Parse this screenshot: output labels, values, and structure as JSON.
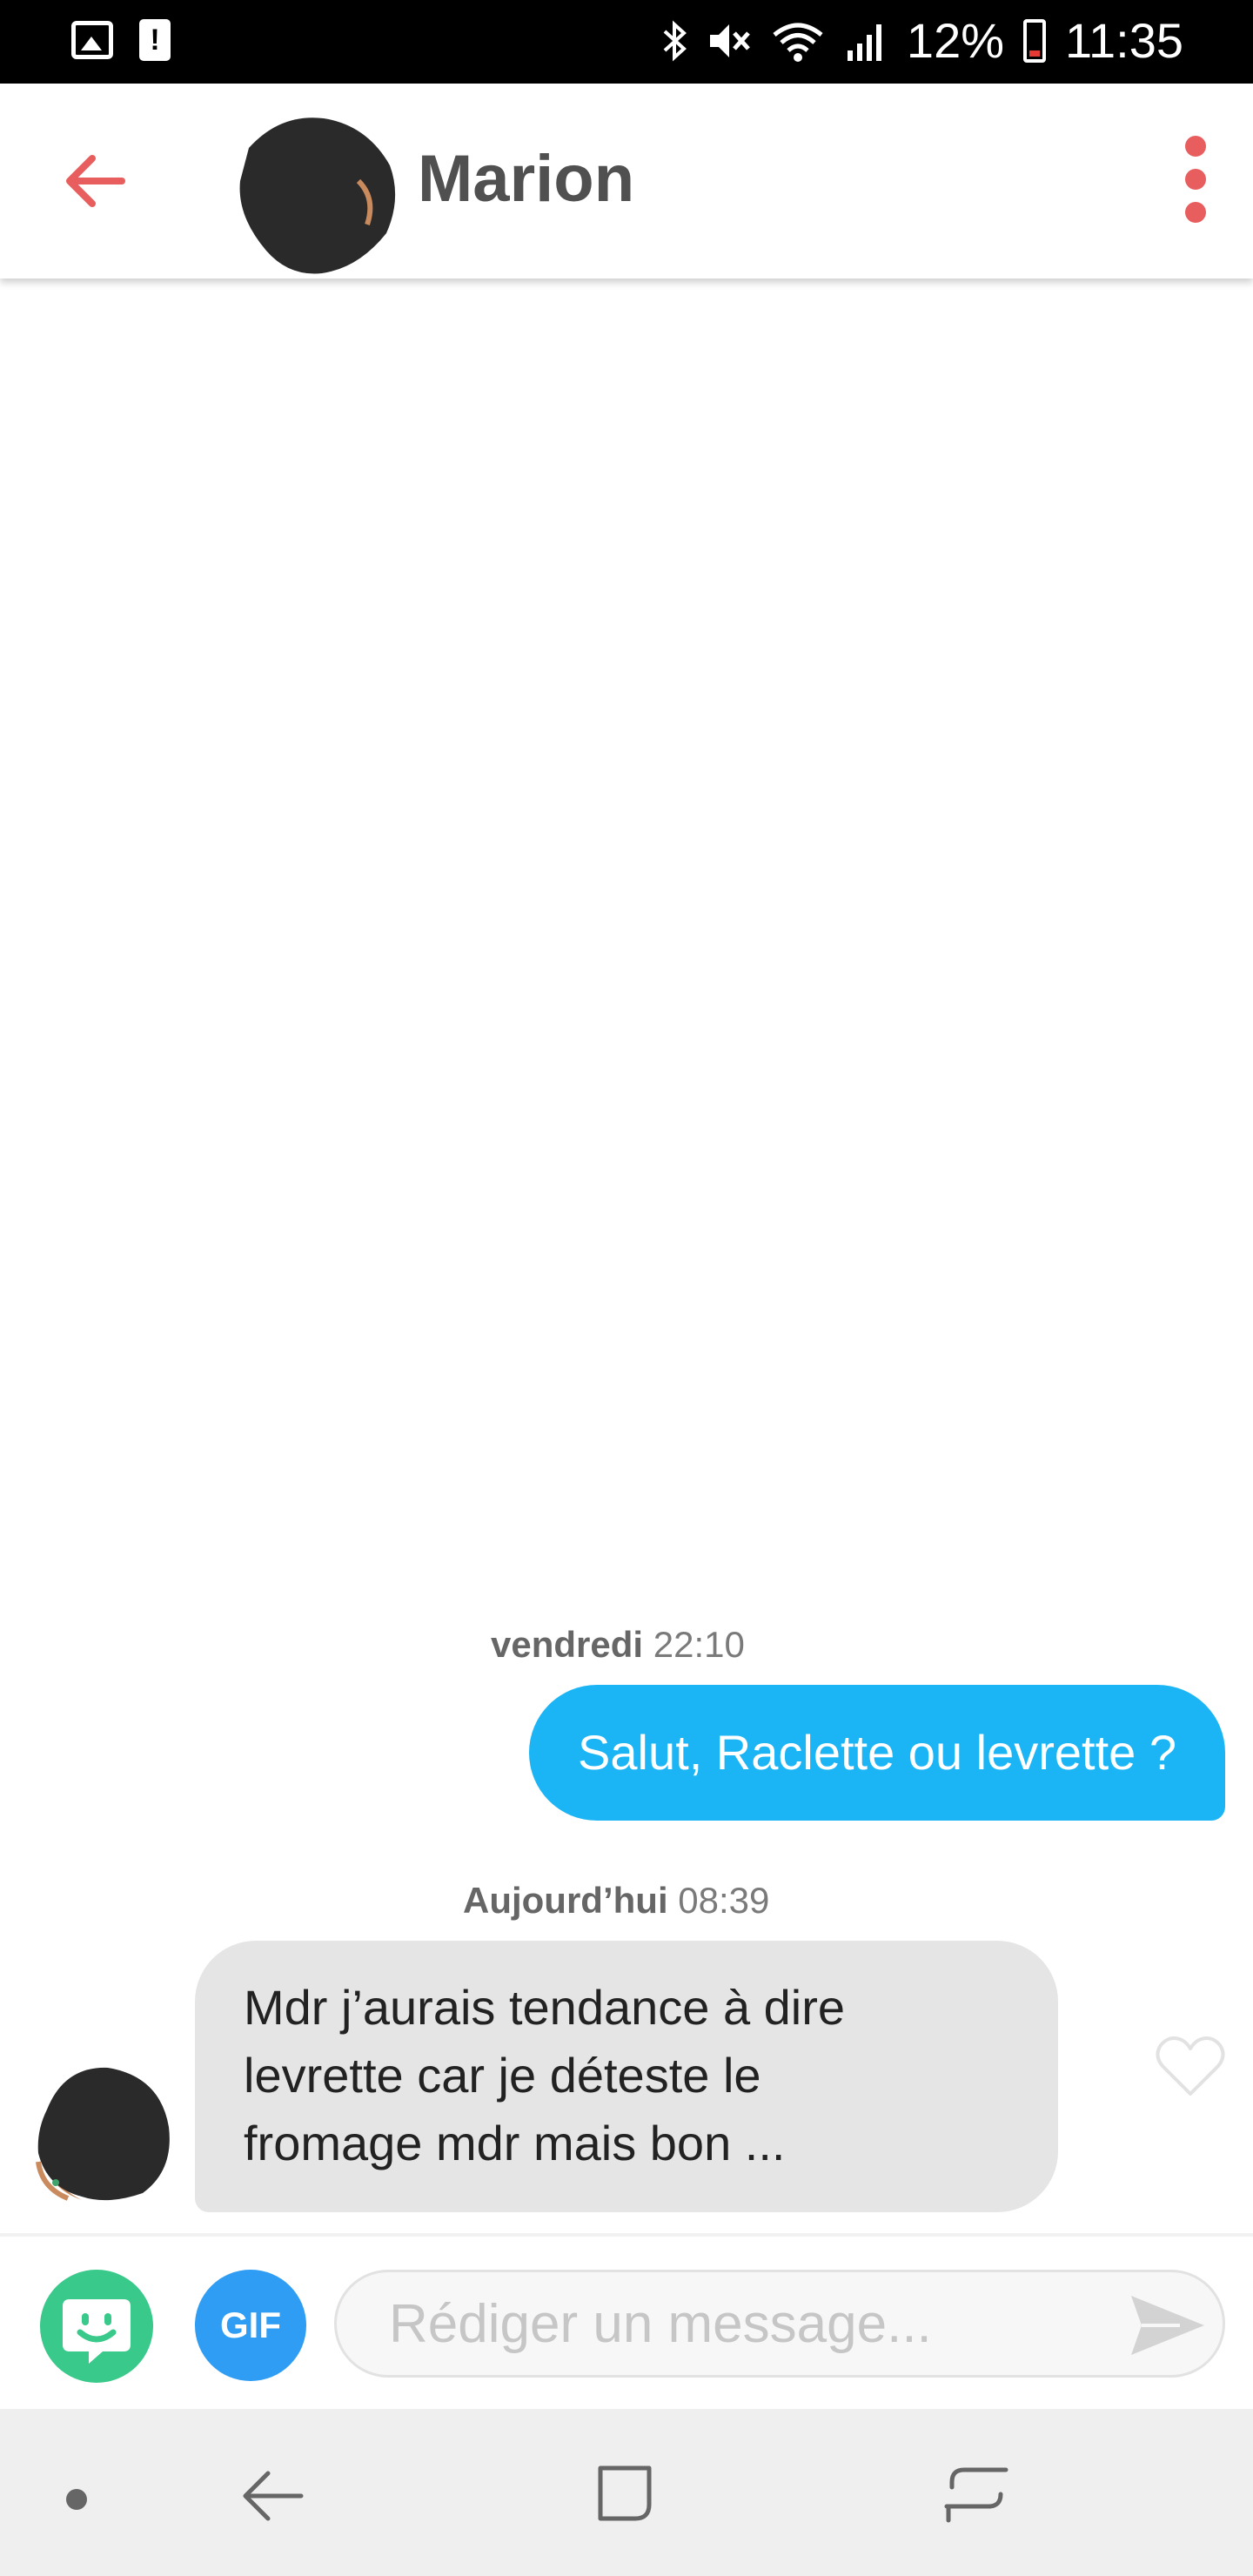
{
  "status_bar": {
    "battery_percent": "12%",
    "time": "11:35",
    "left_icons": [
      "image-icon",
      "alert-icon"
    ],
    "right_icons": [
      "bluetooth-icon",
      "mute-icon",
      "wifi-icon",
      "signal-icon",
      "battery-icon"
    ],
    "alert_glyph": "!"
  },
  "header": {
    "contact_name": "Marion",
    "accent_color": "#e85d5d"
  },
  "conversation": {
    "messages": [
      {
        "day": "vendredi",
        "time": "22:10",
        "direction": "outgoing",
        "text": "Salut, Raclette ou levrette ?",
        "bubble_color": "#1bb5f5"
      },
      {
        "day": "Aujourd’hui",
        "time": "08:39",
        "direction": "incoming",
        "lines": [
          "Mdr j’aurais tendance à dire",
          "levrette car je déteste le",
          "fromage mdr mais bon ..."
        ],
        "bubble_color": "#e5e5e5"
      }
    ]
  },
  "composer": {
    "gif_label": "GIF",
    "placeholder": "Rédiger un message...",
    "value": ""
  },
  "nav_bar": {
    "icons": [
      "nav-dot-icon",
      "nav-back-icon",
      "nav-home-icon",
      "nav-recent-icon"
    ]
  }
}
